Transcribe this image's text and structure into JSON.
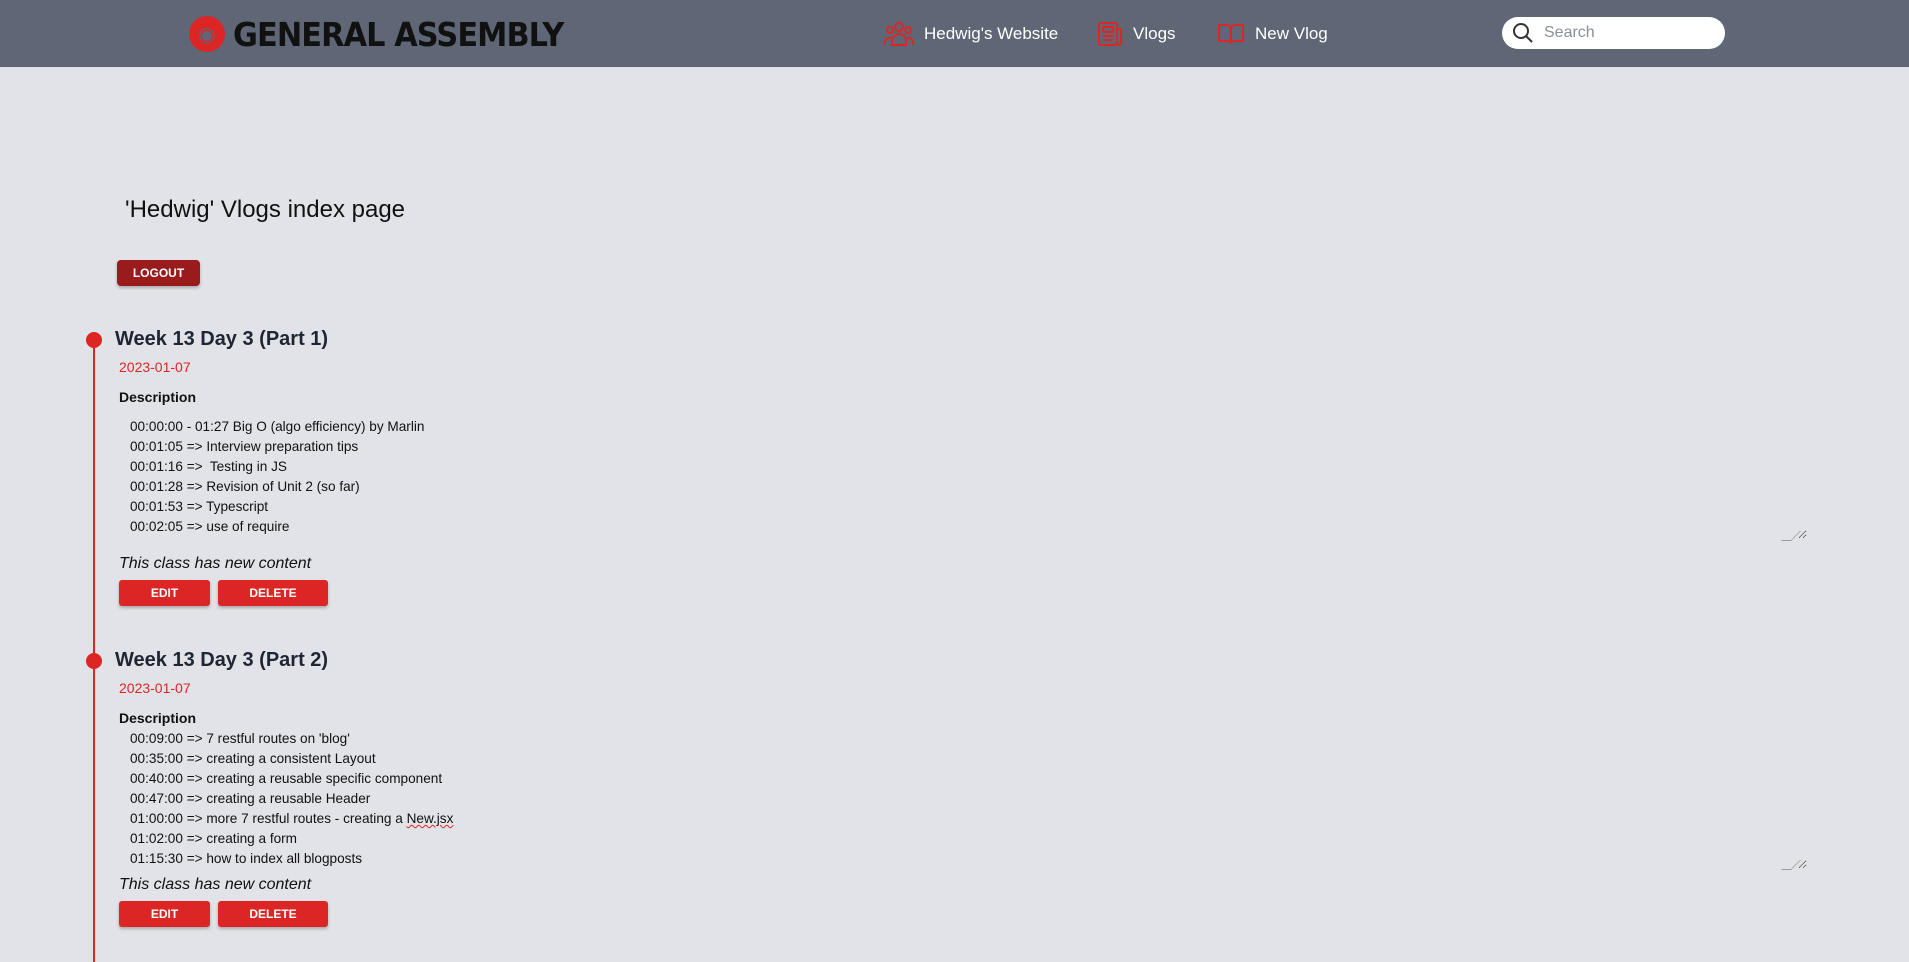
{
  "navbar": {
    "logo_text": "GENERAL ASSEMBLY",
    "logo_icon": "general-assembly-logo",
    "links": [
      {
        "label": "Hedwig's Website",
        "icon": "users-icon"
      },
      {
        "label": "Vlogs",
        "icon": "newspaper-icon"
      },
      {
        "label": "New Vlog",
        "icon": "book-open-icon"
      }
    ],
    "search": {
      "placeholder": "Search",
      "value": ""
    }
  },
  "page": {
    "title": "'Hedwig' Vlogs index page",
    "logout_label": "LOGOUT"
  },
  "vlogs": [
    {
      "title": "Week 13 Day 3 (Part 1)",
      "date": "2023-01-07",
      "description_label": "Description",
      "description_lines": [
        "00:00:00 - 01:27 Big O (algo efficiency) by Marlin",
        "00:01:05 => Interview preparation tips",
        "00:01:16 =>  Testing in JS",
        "00:01:28 => Revision of Unit 2 (so far)",
        "00:01:53 => Typescript",
        "00:02:05 => use of require"
      ],
      "note": "This class has new content",
      "edit_label": "EDIT",
      "delete_label": "DELETE"
    },
    {
      "title": "Week 13 Day 3 (Part 2)",
      "date": "2023-01-07",
      "description_label": "Description",
      "description_lines": [
        "00:09:00 => 7 restful routes on 'blog'",
        "00:35:00 => creating a consistent Layout",
        "00:40:00 => creating a reusable specific component",
        "00:47:00 => creating a reusable Header",
        "01:00:00 => more 7 restful routes - creating a ",
        "01:02:00 => creating a form",
        "01:15:30 => how to index all blogposts"
      ],
      "misspelled_word": "New.jsx",
      "note": "This class has new content",
      "edit_label": "EDIT",
      "delete_label": "DELETE"
    }
  ],
  "colors": {
    "navbar_bg": "#5f6675",
    "page_bg": "#e2e3e8",
    "accent_red": "#dc2626",
    "logout_red": "#991b1b"
  }
}
